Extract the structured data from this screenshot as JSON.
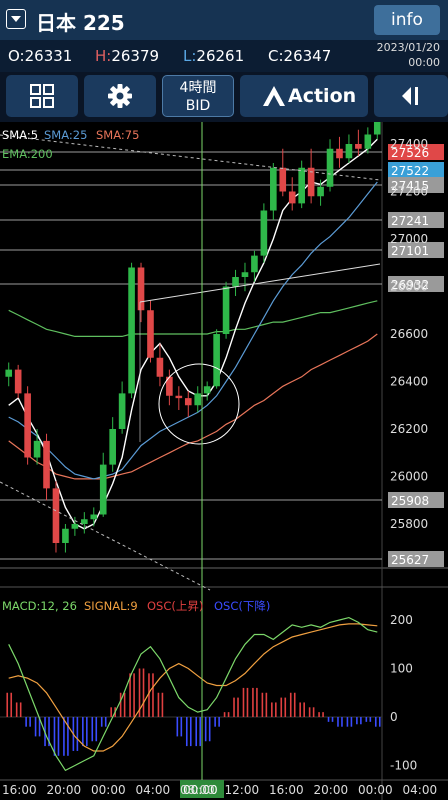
{
  "header": {
    "symbol": "日本 225",
    "info_label": "info"
  },
  "ohlc": {
    "open_label": "O:",
    "open": "26331",
    "high_label": "H:",
    "high": "26379",
    "low_label": "L:",
    "low": "26261",
    "close_label": "C:",
    "close": "26347",
    "date": "2023/01/20",
    "time": "00:00"
  },
  "toolbar": {
    "timeframe_line1": "4時間",
    "timeframe_line2": "BID",
    "action_label": "Action"
  },
  "indicators": {
    "sma5": "SMA:5",
    "sma25": "SMA:25",
    "sma75": "SMA:75",
    "ema200": "EMA:200"
  },
  "macd_legend": {
    "macd": "MACD:12, 26",
    "signal": "SIGNAL:9",
    "osc_up": "OSC(上昇)",
    "osc_down": "OSC(下降)"
  },
  "price_axis": [
    "27400",
    "27200",
    "27000",
    "26800",
    "26600",
    "26400",
    "26200",
    "26000",
    "25800"
  ],
  "price_tags": [
    {
      "label": "27526",
      "color": "#e04848"
    },
    {
      "label": "27522",
      "color": "#3aa0d8"
    },
    {
      "label": "27415",
      "color": "#9a9a9a"
    },
    {
      "label": "27241",
      "color": "#9a9a9a"
    },
    {
      "label": "27101",
      "color": "#9a9a9a"
    },
    {
      "label": "26932",
      "color": "#9a9a9a"
    },
    {
      "label": "25908",
      "color": "#9a9a9a"
    },
    {
      "label": "25627",
      "color": "#9a9a9a"
    }
  ],
  "macd_axis": [
    "200",
    "100",
    "0",
    "-100"
  ],
  "time_axis": [
    "16:00",
    "20:00",
    "00:00",
    "04:00",
    "08:00",
    "12:00",
    "16:00",
    "20:00",
    "00:00",
    "04:00"
  ],
  "crosshair_time": "00:00",
  "chart_data": {
    "type": "candlestick",
    "instrument": "日本 225",
    "ylim": [
      25600,
      27560
    ],
    "candles": [
      {
        "o": 26420,
        "h": 26480,
        "l": 26380,
        "c": 26450
      },
      {
        "o": 26450,
        "h": 26470,
        "l": 26330,
        "c": 26350
      },
      {
        "o": 26350,
        "h": 26380,
        "l": 26050,
        "c": 26080
      },
      {
        "o": 26080,
        "h": 26200,
        "l": 26050,
        "c": 26150
      },
      {
        "o": 26150,
        "h": 26180,
        "l": 25900,
        "c": 25950
      },
      {
        "o": 25950,
        "h": 25980,
        "l": 25680,
        "c": 25720
      },
      {
        "o": 25720,
        "h": 25800,
        "l": 25680,
        "c": 25780
      },
      {
        "o": 25780,
        "h": 25830,
        "l": 25750,
        "c": 25800
      },
      {
        "o": 25800,
        "h": 25850,
        "l": 25760,
        "c": 25820
      },
      {
        "o": 25820,
        "h": 25870,
        "l": 25790,
        "c": 25840
      },
      {
        "o": 25840,
        "h": 26100,
        "l": 25830,
        "c": 26050
      },
      {
        "o": 26050,
        "h": 26250,
        "l": 26020,
        "c": 26200
      },
      {
        "o": 26200,
        "h": 26400,
        "l": 26180,
        "c": 26350
      },
      {
        "o": 26350,
        "h": 26900,
        "l": 26330,
        "c": 26880
      },
      {
        "o": 26880,
        "h": 26900,
        "l": 26650,
        "c": 26700
      },
      {
        "o": 26700,
        "h": 26740,
        "l": 26480,
        "c": 26500
      },
      {
        "o": 26500,
        "h": 26560,
        "l": 26380,
        "c": 26420
      },
      {
        "o": 26420,
        "h": 26450,
        "l": 26300,
        "c": 26340
      },
      {
        "o": 26340,
        "h": 26380,
        "l": 26280,
        "c": 26330
      },
      {
        "o": 26330,
        "h": 26360,
        "l": 26250,
        "c": 26300
      },
      {
        "o": 26300,
        "h": 26380,
        "l": 26270,
        "c": 26350
      },
      {
        "o": 26350,
        "h": 26400,
        "l": 26320,
        "c": 26380
      },
      {
        "o": 26380,
        "h": 26620,
        "l": 26370,
        "c": 26600
      },
      {
        "o": 26600,
        "h": 26820,
        "l": 26580,
        "c": 26800
      },
      {
        "o": 26800,
        "h": 26870,
        "l": 26760,
        "c": 26840
      },
      {
        "o": 26840,
        "h": 26900,
        "l": 26780,
        "c": 26860
      },
      {
        "o": 26860,
        "h": 26950,
        "l": 26820,
        "c": 26930
      },
      {
        "o": 26930,
        "h": 27150,
        "l": 26900,
        "c": 27120
      },
      {
        "o": 27120,
        "h": 27320,
        "l": 27080,
        "c": 27300
      },
      {
        "o": 27300,
        "h": 27380,
        "l": 27180,
        "c": 27200
      },
      {
        "o": 27200,
        "h": 27260,
        "l": 27120,
        "c": 27150
      },
      {
        "o": 27150,
        "h": 27330,
        "l": 27130,
        "c": 27300
      },
      {
        "o": 27300,
        "h": 27380,
        "l": 27150,
        "c": 27180
      },
      {
        "o": 27180,
        "h": 27250,
        "l": 27140,
        "c": 27220
      },
      {
        "o": 27220,
        "h": 27420,
        "l": 27200,
        "c": 27380
      },
      {
        "o": 27380,
        "h": 27430,
        "l": 27300,
        "c": 27340
      },
      {
        "o": 27340,
        "h": 27440,
        "l": 27320,
        "c": 27400
      },
      {
        "o": 27400,
        "h": 27460,
        "l": 27350,
        "c": 27380
      },
      {
        "o": 27380,
        "h": 27470,
        "l": 27360,
        "c": 27440
      },
      {
        "o": 27440,
        "h": 27530,
        "l": 27420,
        "c": 27510
      }
    ],
    "sma5": [
      26300,
      26330,
      26250,
      26180,
      26100,
      25980,
      25870,
      25800,
      25780,
      25800,
      25880,
      25970,
      26080,
      26280,
      26450,
      26520,
      26560,
      26500,
      26420,
      26360,
      26340,
      26340,
      26400,
      26500,
      26620,
      26730,
      26820,
      26900,
      27000,
      27120,
      27170,
      27200,
      27240,
      27230,
      27260,
      27290,
      27320,
      27350,
      27380,
      27420
    ],
    "sma25": [
      26250,
      26230,
      26200,
      26170,
      26120,
      26080,
      26040,
      26010,
      26000,
      25990,
      26000,
      26010,
      26030,
      26080,
      26130,
      26160,
      26190,
      26210,
      26230,
      26250,
      26270,
      26300,
      26340,
      26400,
      26460,
      26530,
      26600,
      26670,
      26740,
      26800,
      26850,
      26890,
      26940,
      26980,
      27010,
      27050,
      27090,
      27140,
      27190,
      27240
    ],
    "sma75": [
      26150,
      26120,
      26090,
      26060,
      26040,
      26010,
      26000,
      25990,
      25990,
      25990,
      25990,
      26000,
      26010,
      26020,
      26040,
      26060,
      26080,
      26100,
      26120,
      26140,
      26150,
      26170,
      26190,
      26220,
      26240,
      26270,
      26300,
      26320,
      26350,
      26380,
      26400,
      26420,
      26450,
      26470,
      26490,
      26510,
      26530,
      26550,
      26570,
      26600
    ],
    "ema200": [
      26700,
      26680,
      26660,
      26640,
      26620,
      26610,
      26600,
      26590,
      26590,
      26590,
      26590,
      26590,
      26590,
      26600,
      26600,
      26600,
      26600,
      26600,
      26600,
      26600,
      26600,
      26600,
      26610,
      26610,
      26620,
      26620,
      26630,
      26640,
      26650,
      26650,
      26660,
      26670,
      26680,
      26690,
      26690,
      26700,
      26710,
      26720,
      26730,
      26740
    ],
    "macd": [
      150,
      110,
      60,
      10,
      -40,
      -80,
      -110,
      -100,
      -90,
      -80,
      -40,
      0,
      40,
      90,
      130,
      145,
      120,
      80,
      40,
      20,
      10,
      15,
      40,
      80,
      120,
      150,
      170,
      170,
      160,
      175,
      190,
      185,
      190,
      185,
      195,
      200,
      205,
      195,
      180,
      175
    ],
    "signal": [
      80,
      85,
      80,
      70,
      50,
      20,
      -10,
      -40,
      -60,
      -70,
      -70,
      -60,
      -40,
      -10,
      20,
      55,
      80,
      100,
      110,
      100,
      85,
      70,
      65,
      65,
      75,
      90,
      110,
      130,
      145,
      155,
      165,
      170,
      175,
      180,
      185,
      190,
      192,
      192,
      190,
      188
    ],
    "osc": [
      50,
      30,
      -20,
      -40,
      -60,
      -80,
      -80,
      -70,
      -60,
      -50,
      -20,
      20,
      50,
      90,
      100,
      90,
      50,
      0,
      -40,
      -60,
      -60,
      -50,
      -20,
      10,
      40,
      60,
      60,
      50,
      30,
      40,
      50,
      30,
      20,
      10,
      -10,
      -20,
      -20,
      -15,
      -10,
      -20
    ]
  }
}
